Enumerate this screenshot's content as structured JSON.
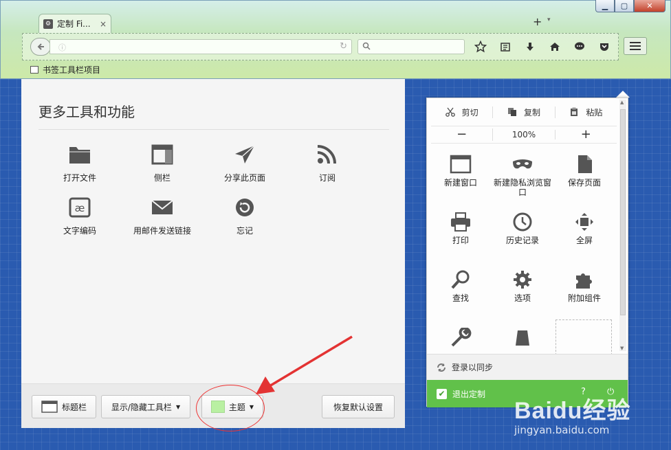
{
  "browser": {
    "tab_title": "定制 Fi...",
    "tab_close": "×",
    "new_tab": "+",
    "tab_list": "▾",
    "bookmarks_label": "书签工具栏项目"
  },
  "palette": {
    "title": "更多工具和功能",
    "items": [
      {
        "label": "打开文件",
        "icon": "folder-icon"
      },
      {
        "label": "侧栏",
        "icon": "sidebar-icon"
      },
      {
        "label": "分享此页面",
        "icon": "share-icon"
      },
      {
        "label": "订阅",
        "icon": "rss-icon"
      },
      {
        "label": "文字编码",
        "icon": "encoding-icon"
      },
      {
        "label": "用邮件发送链接",
        "icon": "email-icon"
      },
      {
        "label": "忘记",
        "icon": "forget-icon"
      }
    ]
  },
  "footer": {
    "titlebar_btn": "标题栏",
    "toolbars_btn": "显示/隐藏工具栏",
    "theme_btn": "主题",
    "restore_btn": "恢复默认设置"
  },
  "menu": {
    "cut": "剪切",
    "copy": "复制",
    "paste": "粘贴",
    "zoom_out": "−",
    "zoom_level": "100%",
    "zoom_in": "+",
    "items": [
      {
        "label": "新建窗口",
        "icon": "window-icon"
      },
      {
        "label": "新建隐私浏览窗口",
        "icon": "mask-icon"
      },
      {
        "label": "保存页面",
        "icon": "page-icon"
      },
      {
        "label": "打印",
        "icon": "print-icon"
      },
      {
        "label": "历史记录",
        "icon": "clock-icon"
      },
      {
        "label": "全屏",
        "icon": "fullscreen-icon"
      },
      {
        "label": "查找",
        "icon": "magnifier-icon"
      },
      {
        "label": "选项",
        "icon": "gear-icon"
      },
      {
        "label": "附加组件",
        "icon": "puzzle-icon"
      }
    ],
    "sync": "登录以同步",
    "exit": "退出定制"
  },
  "watermark": {
    "logo": "Baidu经验",
    "url": "jingyan.baidu.com"
  },
  "colors": {
    "exit_green": "#61c14a",
    "theme_swatch": "#b9f0a2",
    "annotation_red": "#e33333"
  }
}
